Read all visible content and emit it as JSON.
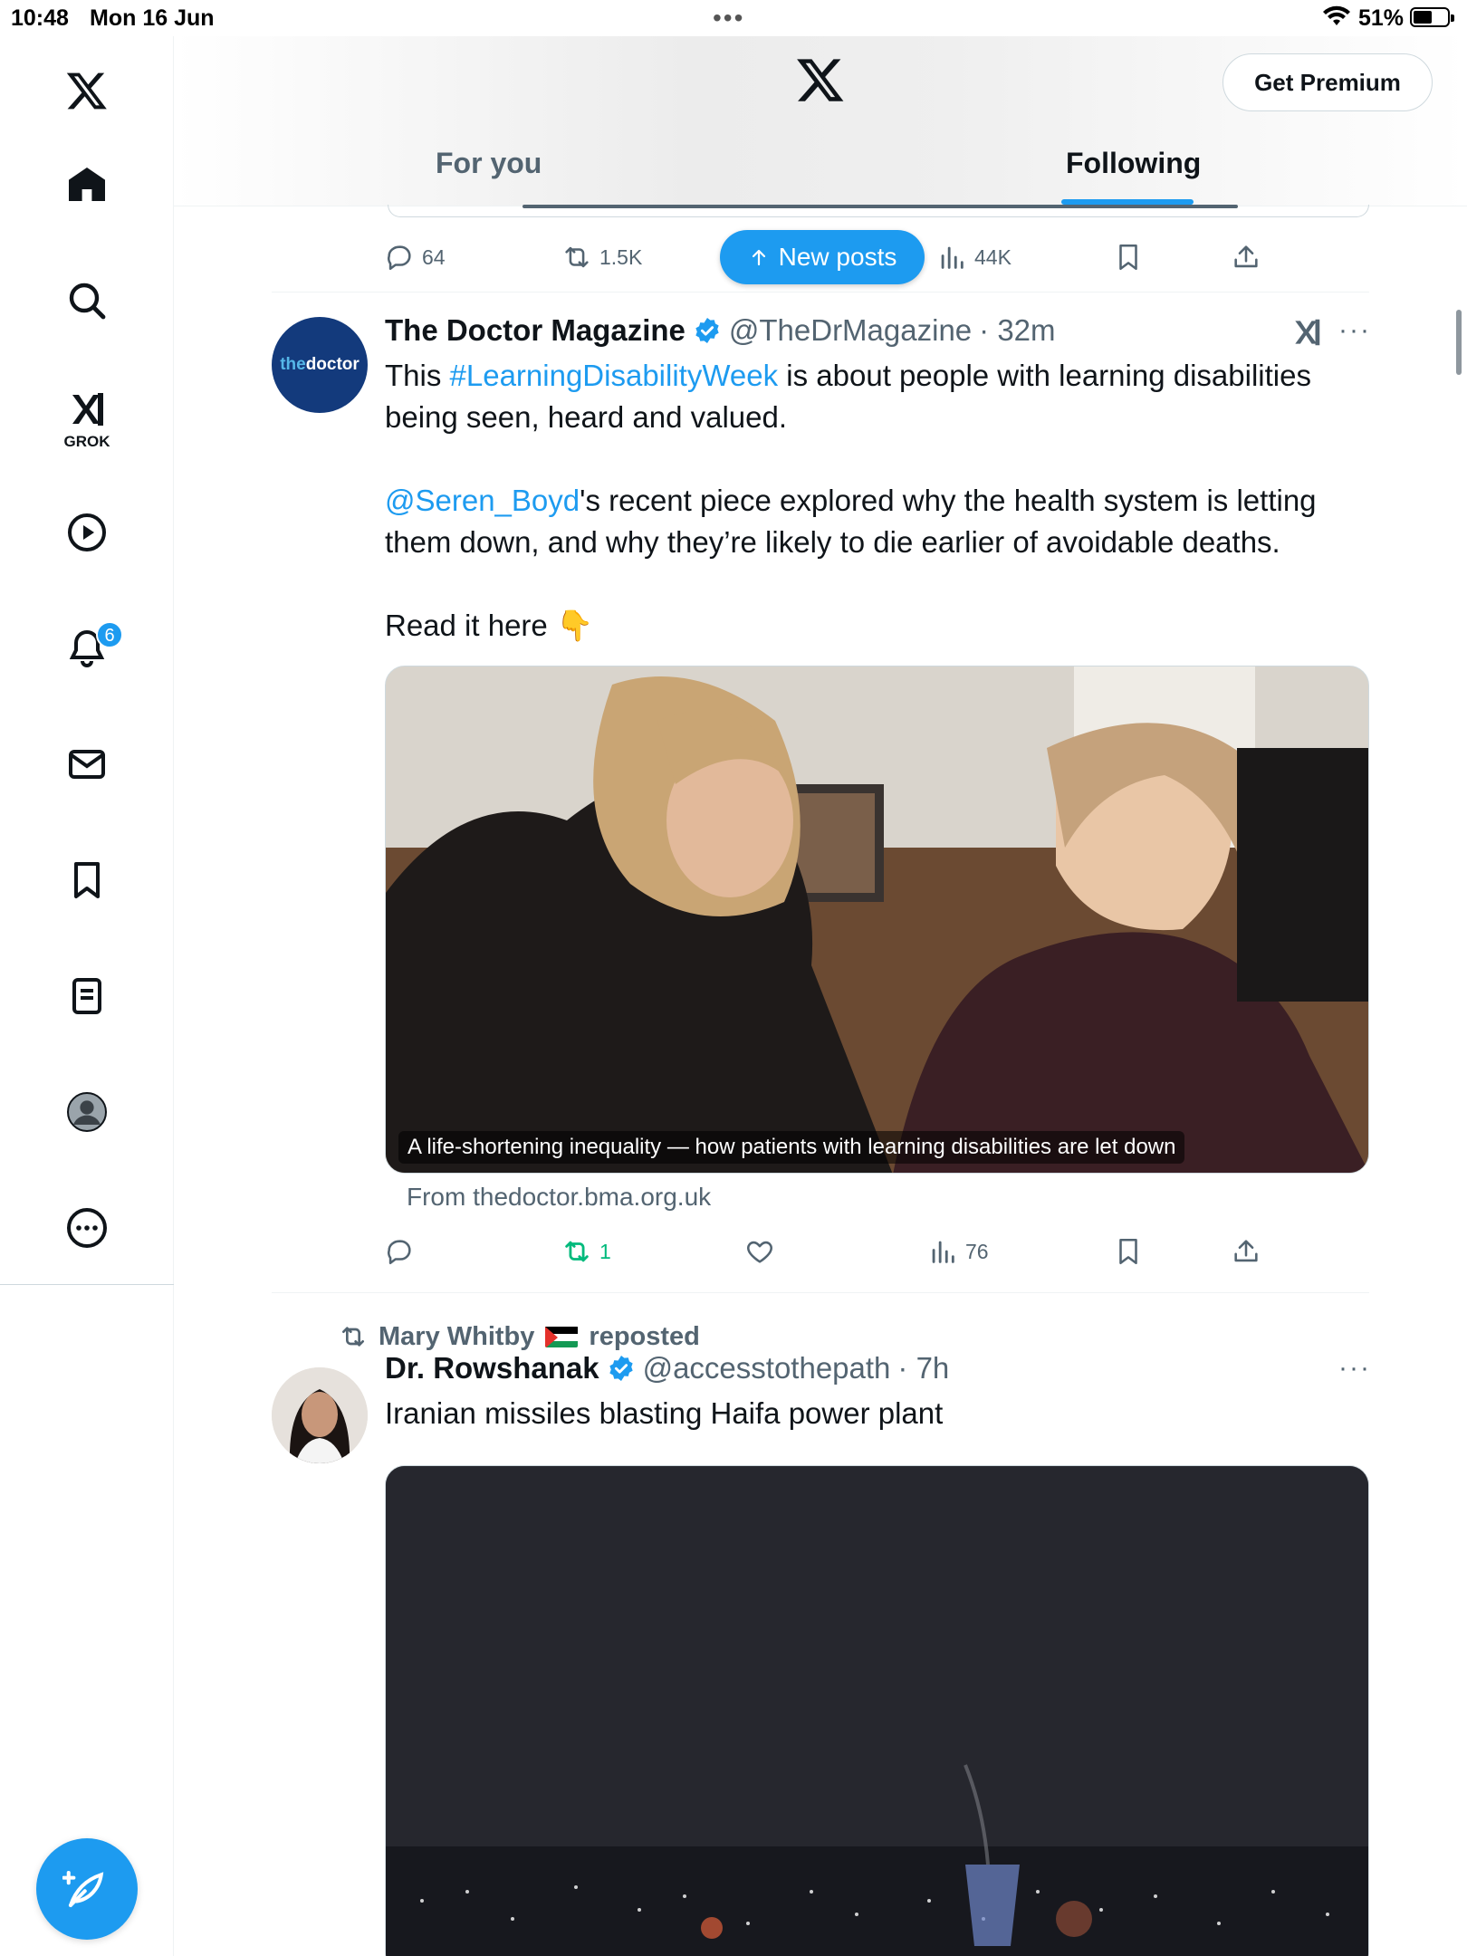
{
  "status_bar": {
    "time": "10:48",
    "date": "Mon 16 Jun",
    "battery": "51%"
  },
  "sidebar": {
    "grok_label": "GROK",
    "notifications_badge": "6",
    "items": [
      "home-icon",
      "search-icon",
      "grok-icon",
      "video-icon",
      "bell-icon",
      "mail-icon",
      "bookmark-icon",
      "list-icon",
      "profile-icon",
      "more-icon"
    ]
  },
  "header": {
    "premium_label": "Get Premium",
    "tabs": [
      {
        "label": "For you",
        "active": false
      },
      {
        "label": "Following",
        "active": true
      }
    ]
  },
  "new_posts_label": "New posts",
  "top_tweet_actions": {
    "replies": "64",
    "reposts": "1.5K",
    "views": "44K"
  },
  "tweets": [
    {
      "avatar_text_a": "the",
      "avatar_text_b": "doctor",
      "name": "The Doctor Magazine",
      "handle": "@TheDrMagazine",
      "time": "· 32m",
      "text_1a": "This ",
      "hashtag": "#LearningDisabilityWeek",
      "text_1b": " is about people with learning disabilities being seen, heard and valued.",
      "mention": "@Seren_Boyd",
      "text_2": "'s recent piece explored why the health system is letting them down, and why they’re likely to die earlier of avoidable deaths.",
      "text_3": "Read it here 👇",
      "media_caption": "A life-shortening inequality — how patients with learning disabilities are let down",
      "from_link": "From thedoctor.bma.org.uk",
      "reposts": "1",
      "views": "76"
    },
    {
      "reposted_by": "Mary Whitby",
      "reposted_suffix": "reposted",
      "name": "Dr. Rowshanak",
      "handle": "@accesstothepath",
      "time": "· 7h",
      "text": "Iranian missiles blasting Haifa power plant"
    }
  ],
  "colors": {
    "accent": "#1d9bf0",
    "secondary_text": "#536471",
    "repost_green": "#00ba7c"
  }
}
